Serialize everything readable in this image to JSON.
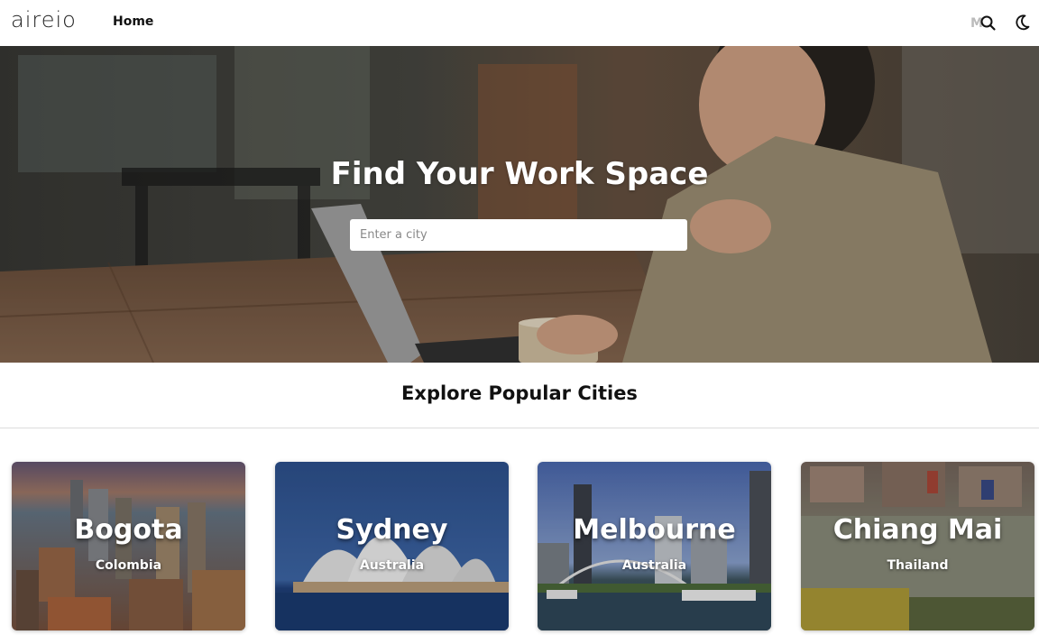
{
  "header": {
    "logo": "aireio",
    "nav": {
      "home_label": "Home"
    },
    "icons": {
      "search": "search-icon",
      "theme": "moon-icon"
    }
  },
  "hero": {
    "title": "Find Your Work Space",
    "search": {
      "placeholder": "Enter a city",
      "value": ""
    }
  },
  "popular": {
    "title": "Explore Popular Cities",
    "cities": [
      {
        "name": "Bogota",
        "country": "Colombia"
      },
      {
        "name": "Sydney",
        "country": "Australia"
      },
      {
        "name": "Melbourne",
        "country": "Australia"
      },
      {
        "name": "Chiang Mai",
        "country": "Thailand"
      }
    ]
  }
}
